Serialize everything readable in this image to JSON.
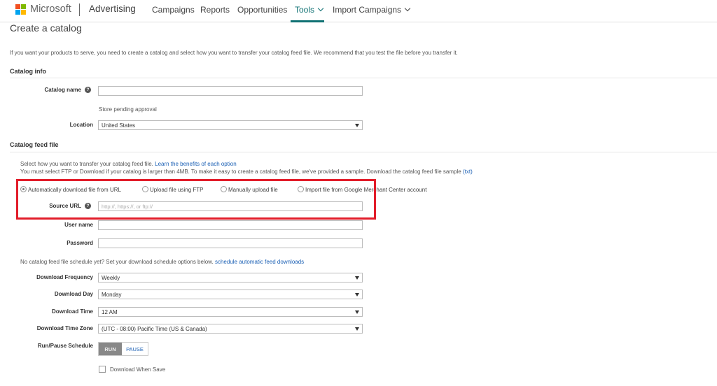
{
  "nav": {
    "brand": "Microsoft",
    "product": "Advertising",
    "items": [
      {
        "label": "Campaigns"
      },
      {
        "label": "Reports"
      },
      {
        "label": "Opportunities"
      },
      {
        "label": "Tools"
      },
      {
        "label": "Import Campaigns"
      }
    ],
    "active": "Tools"
  },
  "page": {
    "title": "Create a catalog",
    "intro": "If you want your products to serve, you need to create a catalog and select how you want to transfer your catalog feed file. We recommend that you test the file before you transfer it."
  },
  "catalog_info": {
    "heading": "Catalog info",
    "name_label": "Catalog name",
    "name_value": "",
    "status": "Store pending approval",
    "location_label": "Location",
    "location_value": "United States"
  },
  "feed": {
    "heading": "Catalog feed file",
    "desc1_text": "Select how you want to transfer your catalog feed file.",
    "desc1_link": "Learn the benefits of each option",
    "desc2_text": "You must select FTP or Download if your catalog is larger than 4MB. To make it easy to create a catalog feed file, we've provided a sample. Download the catalog feed file sample",
    "desc2_link": "(txt)",
    "options": [
      {
        "label": "Automatically download file from URL",
        "selected": true
      },
      {
        "label": "Upload file using FTP",
        "selected": false
      },
      {
        "label": "Manually upload file",
        "selected": false
      },
      {
        "label": "Import file from Google Merchant Center account",
        "selected": false
      }
    ],
    "source_url_label": "Source URL",
    "source_url_placeholder": "http://, https://, or ftp://",
    "username_label": "User name",
    "password_label": "Password",
    "schedule_text": "No catalog feed file schedule yet? Set your download schedule options below.",
    "schedule_link": "schedule automatic feed downloads",
    "frequency_label": "Download Frequency",
    "frequency_value": "Weekly",
    "day_label": "Download Day",
    "day_value": "Monday",
    "time_label": "Download Time",
    "time_value": "12 AM",
    "timezone_label": "Download Time Zone",
    "timezone_value": "(UTC - 08:00) Pacific Time (US & Canada)",
    "runpause_label": "Run/Pause Schedule",
    "run_label": "RUN",
    "pause_label": "PAUSE",
    "download_when_save_label": "Download When Save"
  },
  "colors": {
    "accent": "#0f7173",
    "highlight_box": "#e21d2a",
    "link": "#1a5fb4"
  }
}
